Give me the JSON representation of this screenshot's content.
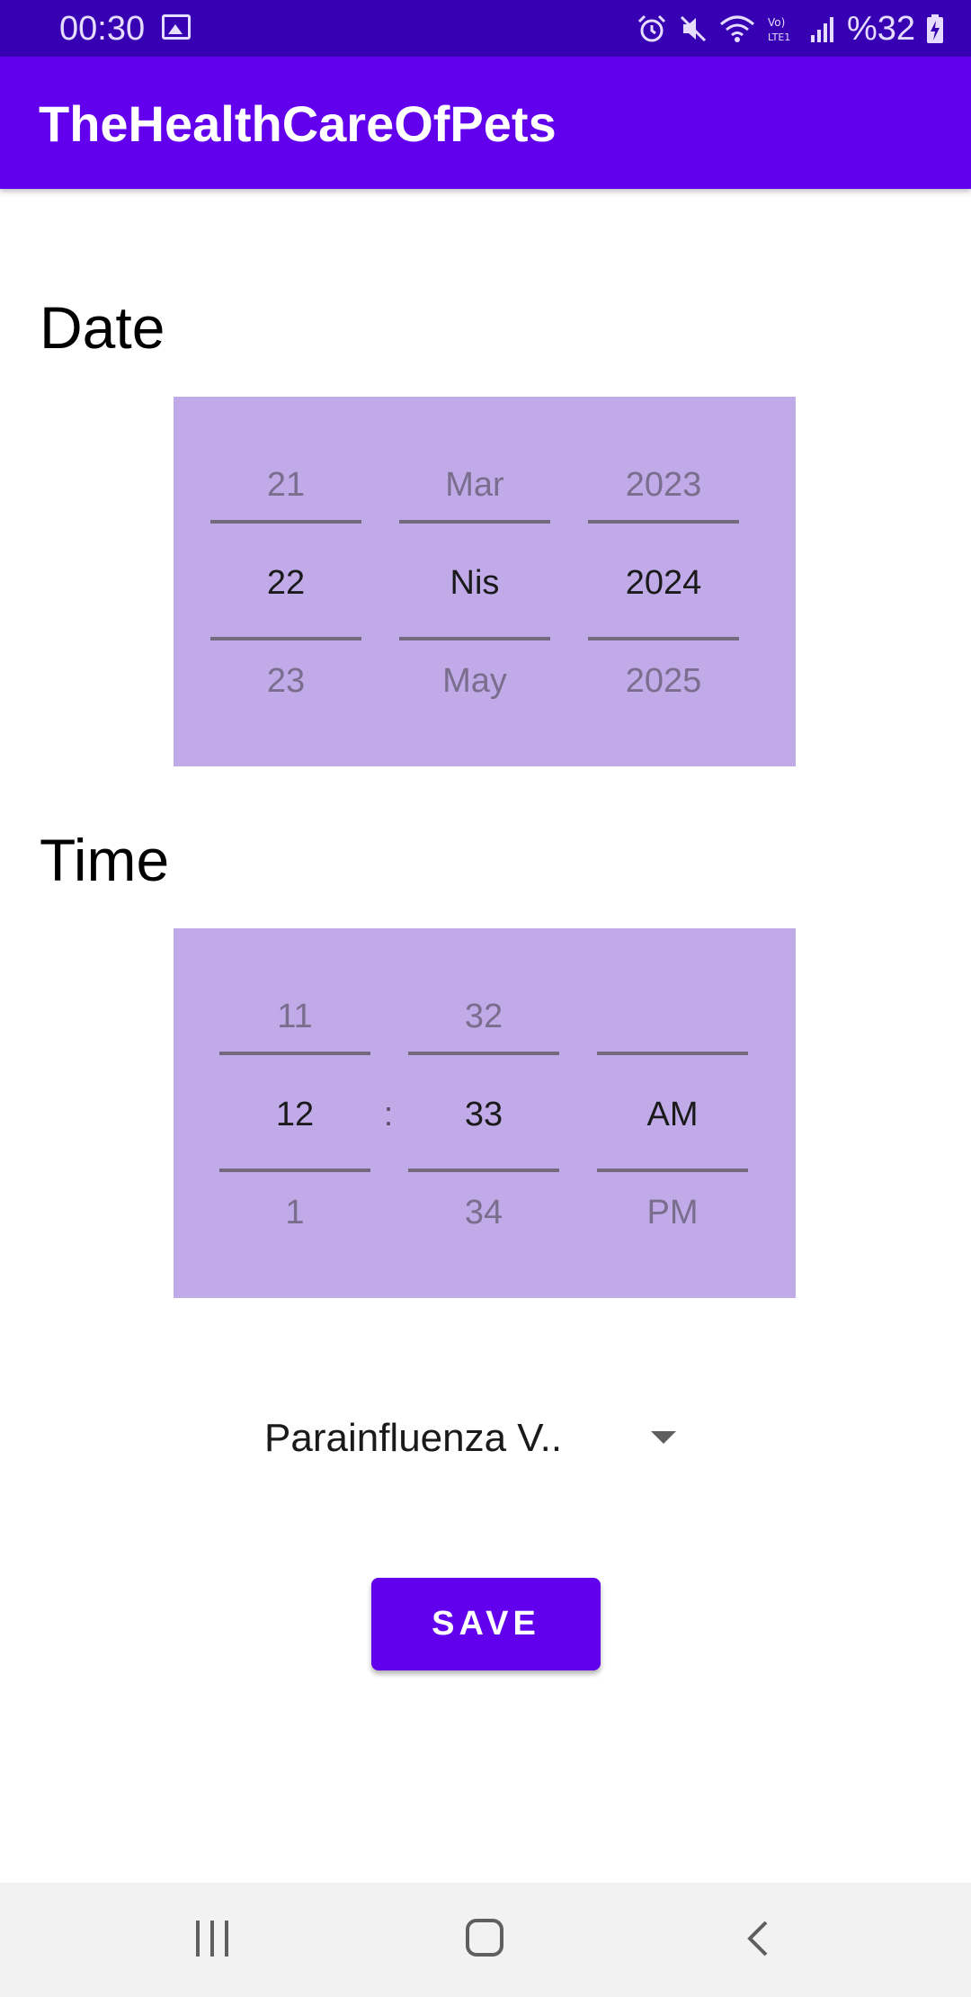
{
  "status_bar": {
    "time": "00:30",
    "battery_text": "%32",
    "icons": [
      "image-icon",
      "alarm-icon",
      "mute-icon",
      "wifi-icon",
      "volte-icon",
      "signal-icon",
      "battery-charging-icon"
    ]
  },
  "app_bar": {
    "title": "TheHealthCareOfPets"
  },
  "date_section": {
    "label": "Date",
    "day": {
      "prev": "21",
      "current": "22",
      "next": "23"
    },
    "month": {
      "prev": "Mar",
      "current": "Nis",
      "next": "May"
    },
    "year": {
      "prev": "2023",
      "current": "2024",
      "next": "2025"
    }
  },
  "time_section": {
    "label": "Time",
    "hour": {
      "prev": "11",
      "current": "12",
      "next": "1"
    },
    "separator": ":",
    "minute": {
      "prev": "32",
      "current": "33",
      "next": "34"
    },
    "ampm": {
      "prev": "",
      "current": "AM",
      "next": "PM"
    }
  },
  "spinner": {
    "selected": "Parainfluenza V.."
  },
  "save_label": "SAVE",
  "nav_bar": {
    "icons": [
      "recent-apps-icon",
      "home-icon",
      "back-icon"
    ]
  },
  "colors": {
    "status_bar": "#3700b3",
    "app_bar": "#6200ee",
    "picker_bg": "#c0abe8",
    "button": "#6200ee"
  }
}
